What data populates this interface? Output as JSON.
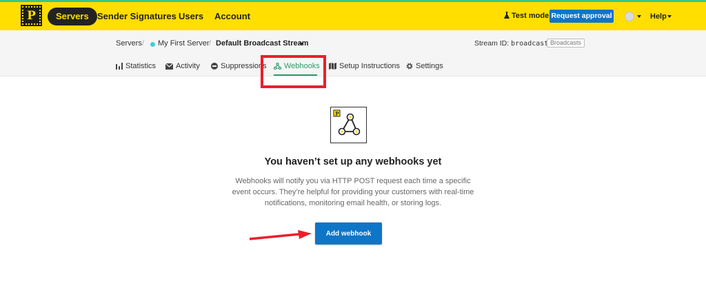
{
  "topnav": {
    "logo_letter": "P",
    "items": [
      "Servers",
      "Sender Signatures",
      "Users",
      "Account"
    ],
    "test_mode": "Test mode",
    "request_approval": "Request approval",
    "help": "Help"
  },
  "breadcrumb": {
    "root": "Servers",
    "server": "My First Server",
    "stream": "Default Broadcast Stream",
    "stream_id_label": "Stream ID:",
    "stream_id_value": "broadcast",
    "stream_badge": "Broadcasts"
  },
  "tabs": [
    "Statistics",
    "Activity",
    "Suppressions",
    "Webhooks",
    "Setup Instructions",
    "Settings"
  ],
  "empty_state": {
    "title": "You haven’t set up any webhooks yet",
    "description": "Webhooks will notify you via HTTP POST request each time a specific event occurs. They’re helpful for providing your customers with real-time notifications, monitoring email health, or storing logs.",
    "button": "Add webhook"
  },
  "colors": {
    "brand_yellow": "#ffde00",
    "primary_blue": "#0f75c7",
    "active_green": "#2d9b6a",
    "annotation_red": "#e8202b"
  }
}
